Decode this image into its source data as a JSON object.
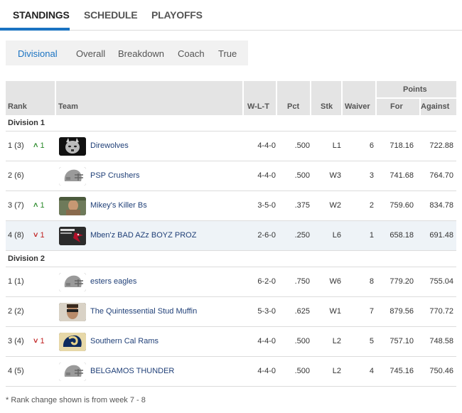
{
  "nav": {
    "tabs": [
      "STANDINGS",
      "SCHEDULE",
      "PLAYOFFS"
    ],
    "active": "STANDINGS"
  },
  "subtabs": {
    "items": [
      "Divisional",
      "Overall",
      "Breakdown",
      "Coach",
      "True"
    ],
    "active": "Divisional"
  },
  "table": {
    "headers": {
      "rank": "Rank",
      "team": "Team",
      "wlt": "W-L-T",
      "pct": "Pct",
      "stk": "Stk",
      "waiver": "Waiver",
      "points": "Points",
      "for": "For",
      "against": "Against"
    },
    "divisions": [
      {
        "name": "Division 1",
        "rows": [
          {
            "rank": "1 (3)",
            "change": "1",
            "dir": "up",
            "logo": "wolf-logo",
            "team": "Direwolves",
            "wlt": "4-4-0",
            "pct": ".500",
            "stk": "L1",
            "waiver": "6",
            "for": "718.16",
            "against": "722.88"
          },
          {
            "rank": "2 (6)",
            "change": "",
            "dir": "",
            "logo": "helmet-logo",
            "team": "PSP Crushers",
            "wlt": "4-4-0",
            "pct": ".500",
            "stk": "W3",
            "waiver": "3",
            "for": "741.68",
            "against": "764.70"
          },
          {
            "rank": "3 (7)",
            "change": "1",
            "dir": "up",
            "logo": "photo-logo",
            "team": "Mikey's Killer Bs",
            "wlt": "3-5-0",
            "pct": ".375",
            "stk": "W2",
            "waiver": "2",
            "for": "759.60",
            "against": "834.78"
          },
          {
            "rank": "4 (8)",
            "change": "1",
            "dir": "down",
            "logo": "cardinal-logo",
            "team": "Mben'z BAD AZz BOYZ PROZ",
            "wlt": "2-6-0",
            "pct": ".250",
            "stk": "L6",
            "waiver": "1",
            "for": "658.18",
            "against": "691.48"
          }
        ]
      },
      {
        "name": "Division 2",
        "rows": [
          {
            "rank": "1 (1)",
            "change": "",
            "dir": "",
            "logo": "helmet-logo",
            "team": "esters eagles",
            "wlt": "6-2-0",
            "pct": ".750",
            "stk": "W6",
            "waiver": "8",
            "for": "779.20",
            "against": "755.04"
          },
          {
            "rank": "2 (2)",
            "change": "",
            "dir": "",
            "logo": "face-logo",
            "team": "The Quintessential Stud Muffin",
            "wlt": "5-3-0",
            "pct": ".625",
            "stk": "W1",
            "waiver": "7",
            "for": "879.56",
            "against": "770.72"
          },
          {
            "rank": "3 (4)",
            "change": "1",
            "dir": "down",
            "logo": "rams-logo",
            "team": "Southern Cal Rams",
            "wlt": "4-4-0",
            "pct": ".500",
            "stk": "L2",
            "waiver": "5",
            "for": "757.10",
            "against": "748.58"
          },
          {
            "rank": "4 (5)",
            "change": "",
            "dir": "",
            "logo": "helmet-logo",
            "team": "BELGAMOS THUNDER",
            "wlt": "4-4-0",
            "pct": ".500",
            "stk": "L2",
            "waiver": "4",
            "for": "745.16",
            "against": "750.46"
          }
        ]
      }
    ]
  },
  "footnote": "* Rank change shown is from week 7 - 8",
  "colors": {
    "accent": "#1a73c2",
    "up": "#2a8a2a",
    "down": "#c02020",
    "link": "#1f3f77"
  }
}
